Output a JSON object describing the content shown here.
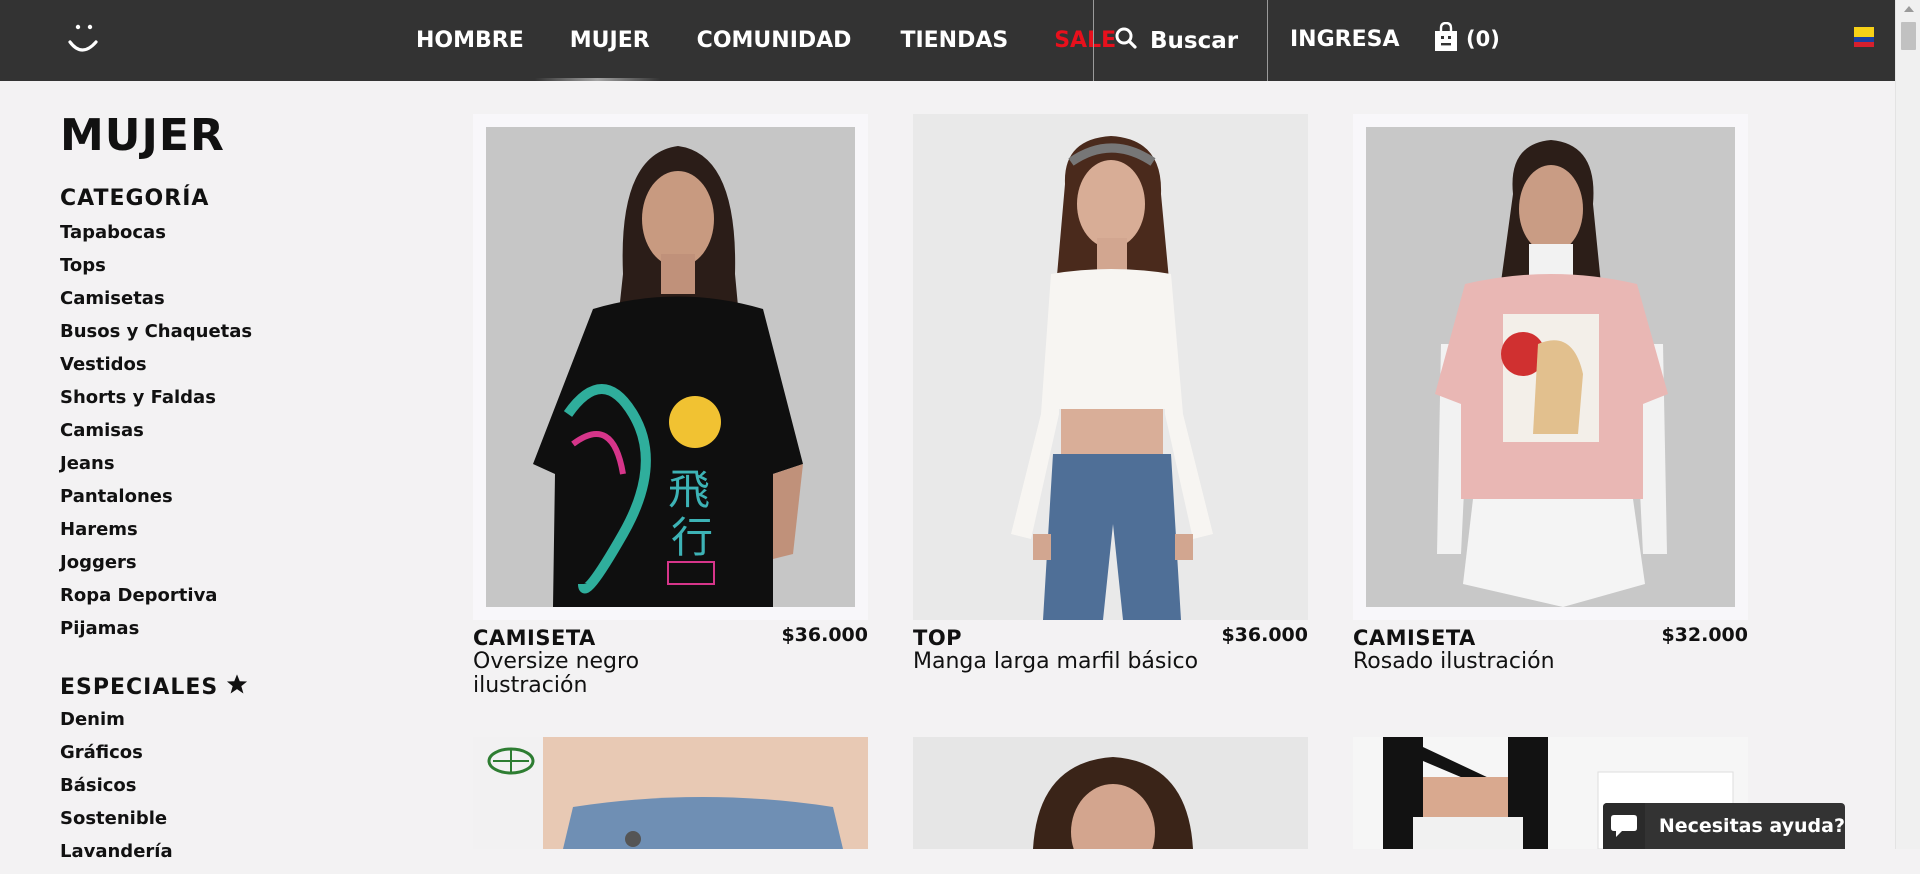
{
  "nav": {
    "links": [
      "HOMBRE",
      "MUJER",
      "COMUNIDAD",
      "TIENDAS",
      "SALE"
    ],
    "search_label": "Buscar",
    "login_label": "INGRESA",
    "cart_count": "(0)",
    "icons": {
      "logo": "smile-logo-icon",
      "search": "search-icon",
      "cart": "shopping-bag-icon",
      "flag": "colombia-flag-icon"
    },
    "colors": {
      "bar": "#333333",
      "sale": "#e8101c"
    }
  },
  "sidebar": {
    "title": "MUJER",
    "category_heading": "CATEGORÍA",
    "categories": [
      "Tapabocas",
      "Tops",
      "Camisetas",
      "Busos y Chaquetas",
      "Vestidos",
      "Shorts y Faldas",
      "Camisas",
      "Jeans",
      "Pantalones",
      "Harems",
      "Joggers",
      "Ropa Deportiva",
      "Pijamas"
    ],
    "specials_heading": "ESPECIALES",
    "specials": [
      "Denim",
      "Gráficos",
      "Básicos",
      "Sostenible",
      "Lavandería"
    ]
  },
  "products": [
    {
      "type": "CAMISETA",
      "name": "Oversize negro ilustración",
      "price": "$36.000"
    },
    {
      "type": "TOP",
      "name": "Manga larga marfil básico",
      "price": "$36.000"
    },
    {
      "type": "CAMISETA",
      "name": "Rosado ilustración",
      "price": "$32.000"
    }
  ],
  "chat": {
    "label": "Necesitas ayuda?",
    "icon": "chat-bubble-icon"
  }
}
